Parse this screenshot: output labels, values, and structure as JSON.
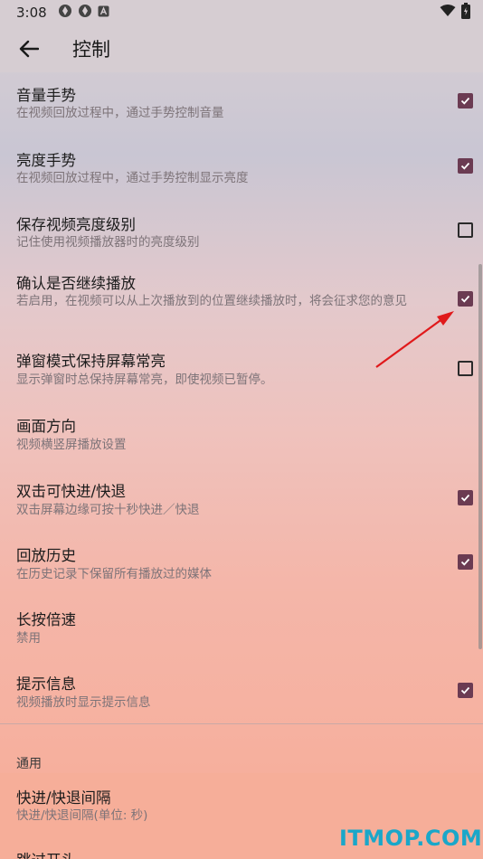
{
  "status": {
    "time": "3:08"
  },
  "appbar": {
    "title": "控制"
  },
  "items": [
    {
      "title": "音量手势",
      "subtitle": "在视频回放过程中，通过手势控制音量",
      "checked": true
    },
    {
      "title": "亮度手势",
      "subtitle": "在视频回放过程中，通过手势控制显示亮度",
      "checked": true
    },
    {
      "title": "保存视频亮度级别",
      "subtitle": "记住使用视频播放器时的亮度级别",
      "checked": false
    },
    {
      "title": "确认是否继续播放",
      "subtitle": "若启用，在视频可以从上次播放到的位置继续播放时，将会征求您的意见",
      "checked": true
    },
    {
      "title": "弹窗模式保持屏幕常亮",
      "subtitle": "显示弹窗时总保持屏幕常亮，即使视频已暂停。",
      "checked": false
    },
    {
      "title": "画面方向",
      "subtitle": "视频横竖屏播放设置"
    },
    {
      "title": "双击可快进/快退",
      "subtitle": "双击屏幕边缘可按十秒快进／快退",
      "checked": true
    },
    {
      "title": "回放历史",
      "subtitle": "在历史记录下保留所有播放过的媒体",
      "checked": true
    },
    {
      "title": "长按倍速",
      "subtitle": "禁用"
    },
    {
      "title": "提示信息",
      "subtitle": "视频播放时显示提示信息",
      "checked": true
    }
  ],
  "section_general": "通用",
  "general_items": [
    {
      "title": "快进/快退间隔",
      "subtitle": "快进/快退间隔(单位: 秒)"
    },
    {
      "title": "跳过开头"
    }
  ],
  "watermark": "ITMOP.COM",
  "colors": {
    "accent": "#6b3b52",
    "arrow": "#e0191b",
    "watermark": "#1aa7c9"
  }
}
